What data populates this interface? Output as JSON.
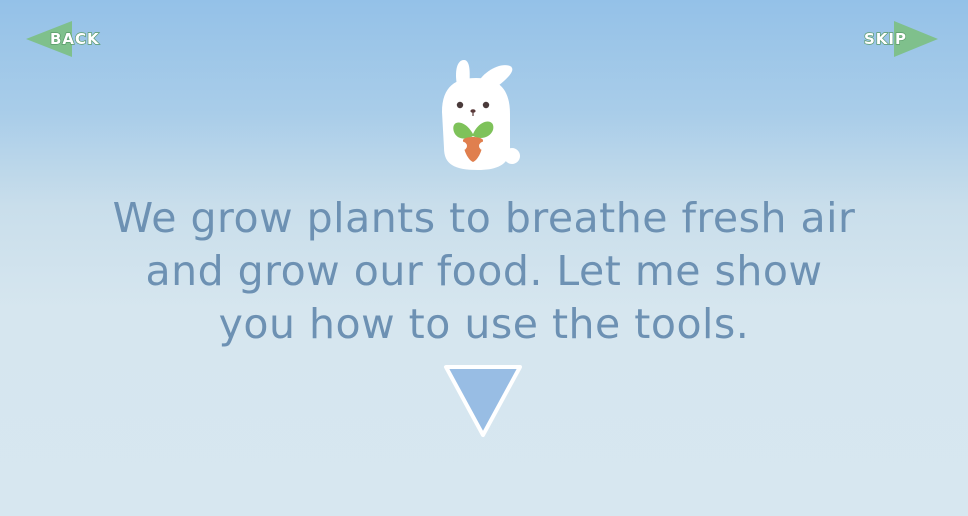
{
  "nav": {
    "back_label": "BACK",
    "skip_label": "SKIP"
  },
  "mascot": {
    "icon": "bunny-holding-sprout-icon"
  },
  "message": {
    "text": "We grow plants to breathe fresh air and grow our food. Let me show you how to use the tools."
  },
  "next": {
    "icon": "down-triangle-arrow-icon"
  },
  "colors": {
    "sky_top": "#94c1e8",
    "sky_bottom": "#d7e7f0",
    "text": "#6d91b3",
    "nav_green": "#7fc08c",
    "arrow_fill": "#98bde4"
  }
}
